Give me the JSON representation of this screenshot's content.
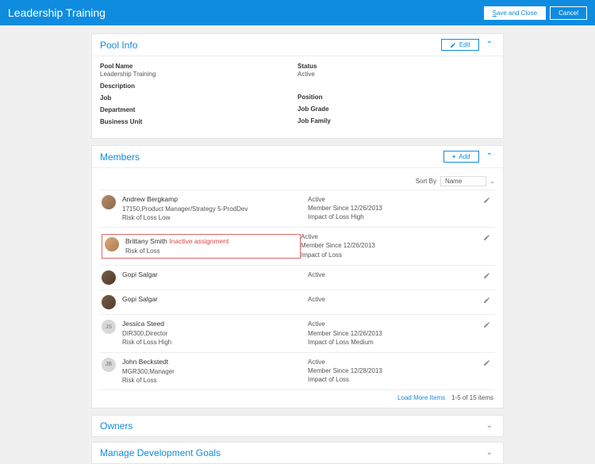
{
  "header": {
    "title": "Leadership Training",
    "save_close": "Save and Close",
    "cancel": "Cancel"
  },
  "pool": {
    "title": "Pool Info",
    "edit_label": "Edit",
    "left": [
      {
        "label": "Pool Name",
        "value": "Leadership Training"
      },
      {
        "label": "Description",
        "value": ""
      },
      {
        "label": "Job",
        "value": ""
      },
      {
        "label": "Department",
        "value": ""
      },
      {
        "label": "Business Unit",
        "value": ""
      }
    ],
    "right": [
      {
        "label": "Status",
        "value": "Active"
      },
      {
        "label": "",
        "value": ""
      },
      {
        "label": "Position",
        "value": ""
      },
      {
        "label": "Job Grade",
        "value": ""
      },
      {
        "label": "Job Family",
        "value": ""
      }
    ]
  },
  "members": {
    "title": "Members",
    "add_label": "Add",
    "sort_label": "Sort By",
    "sort_value": "Name",
    "footer_load": "Load More Items",
    "footer_count": "1-5 of 15 items",
    "list": [
      {
        "name": "Andrew Bergkamp",
        "badge": "",
        "line2": "17150,Product Manager/Strategy 5-ProdDev",
        "line3": "Risk of Loss  Low",
        "r1": "Active",
        "r2": "Member Since  12/26/2013",
        "r3": "Impact of Loss  High",
        "avatar": "img1",
        "highlight": false
      },
      {
        "name": "Brittany Smith",
        "badge": "Inactive assignment",
        "line2": "",
        "line3": "Risk of Loss",
        "r1": "Active",
        "r2": "Member Since  12/26/2013",
        "r3": "Impact of Loss",
        "avatar": "img2",
        "highlight": true
      },
      {
        "name": "Gopi Salgar",
        "badge": "",
        "line2": "",
        "line3": "",
        "r1": "Active",
        "r2": "",
        "r3": "",
        "avatar": "img3",
        "highlight": false
      },
      {
        "name": "Gopi Salgar",
        "badge": "",
        "line2": "",
        "line3": "",
        "r1": "Active",
        "r2": "",
        "r3": "",
        "avatar": "img3",
        "highlight": false
      },
      {
        "name": "Jessica Steed",
        "badge": "",
        "line2": "DIR300,Director",
        "line3": "Risk of Loss  High",
        "r1": "Active",
        "r2": "Member Since  12/26/2013",
        "r3": "Impact of Loss  Medium",
        "avatar": "JS",
        "highlight": false
      },
      {
        "name": "John Beckstedt",
        "badge": "",
        "line2": "MGR300,Manager",
        "line3": "Risk of Loss",
        "r1": "Active",
        "r2": "Member Since  12/28/2013",
        "r3": "Impact of Loss",
        "avatar": "JB",
        "highlight": false
      }
    ]
  },
  "owners": {
    "title": "Owners"
  },
  "goals": {
    "title": "Manage Development Goals"
  }
}
